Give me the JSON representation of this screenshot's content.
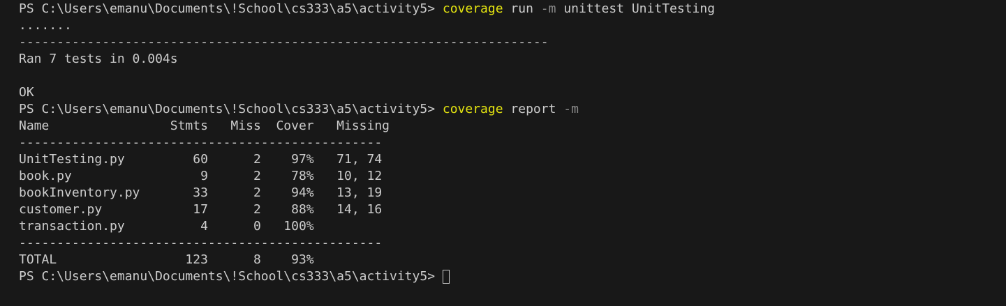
{
  "terminal": {
    "prompt": "PS C:\\Users\\emanu\\Documents\\!School\\cs333\\a5\\activity5>",
    "command1": {
      "program": "coverage",
      "args_before_flag": "run",
      "flag": "-m",
      "args_after_flag": "unittest UnitTesting"
    },
    "test_dots": ".......",
    "test_separator": "----------------------------------------------------------------------",
    "test_summary": "Ran 7 tests in 0.004s",
    "test_result": "OK",
    "command2": {
      "program": "coverage",
      "args_before_flag": "report",
      "flag": "-m"
    },
    "report": {
      "header": "Name                Stmts   Miss  Cover   Missing",
      "separator": "------------------------------------------------",
      "rows": [
        "UnitTesting.py         60      2    97%   71, 74",
        "book.py                 9      2    78%   10, 12",
        "bookInventory.py       33      2    94%   13, 19",
        "customer.py            17      2    88%   14, 16",
        "transaction.py          4      0   100%"
      ],
      "total": "TOTAL                 123      8    93%"
    }
  }
}
